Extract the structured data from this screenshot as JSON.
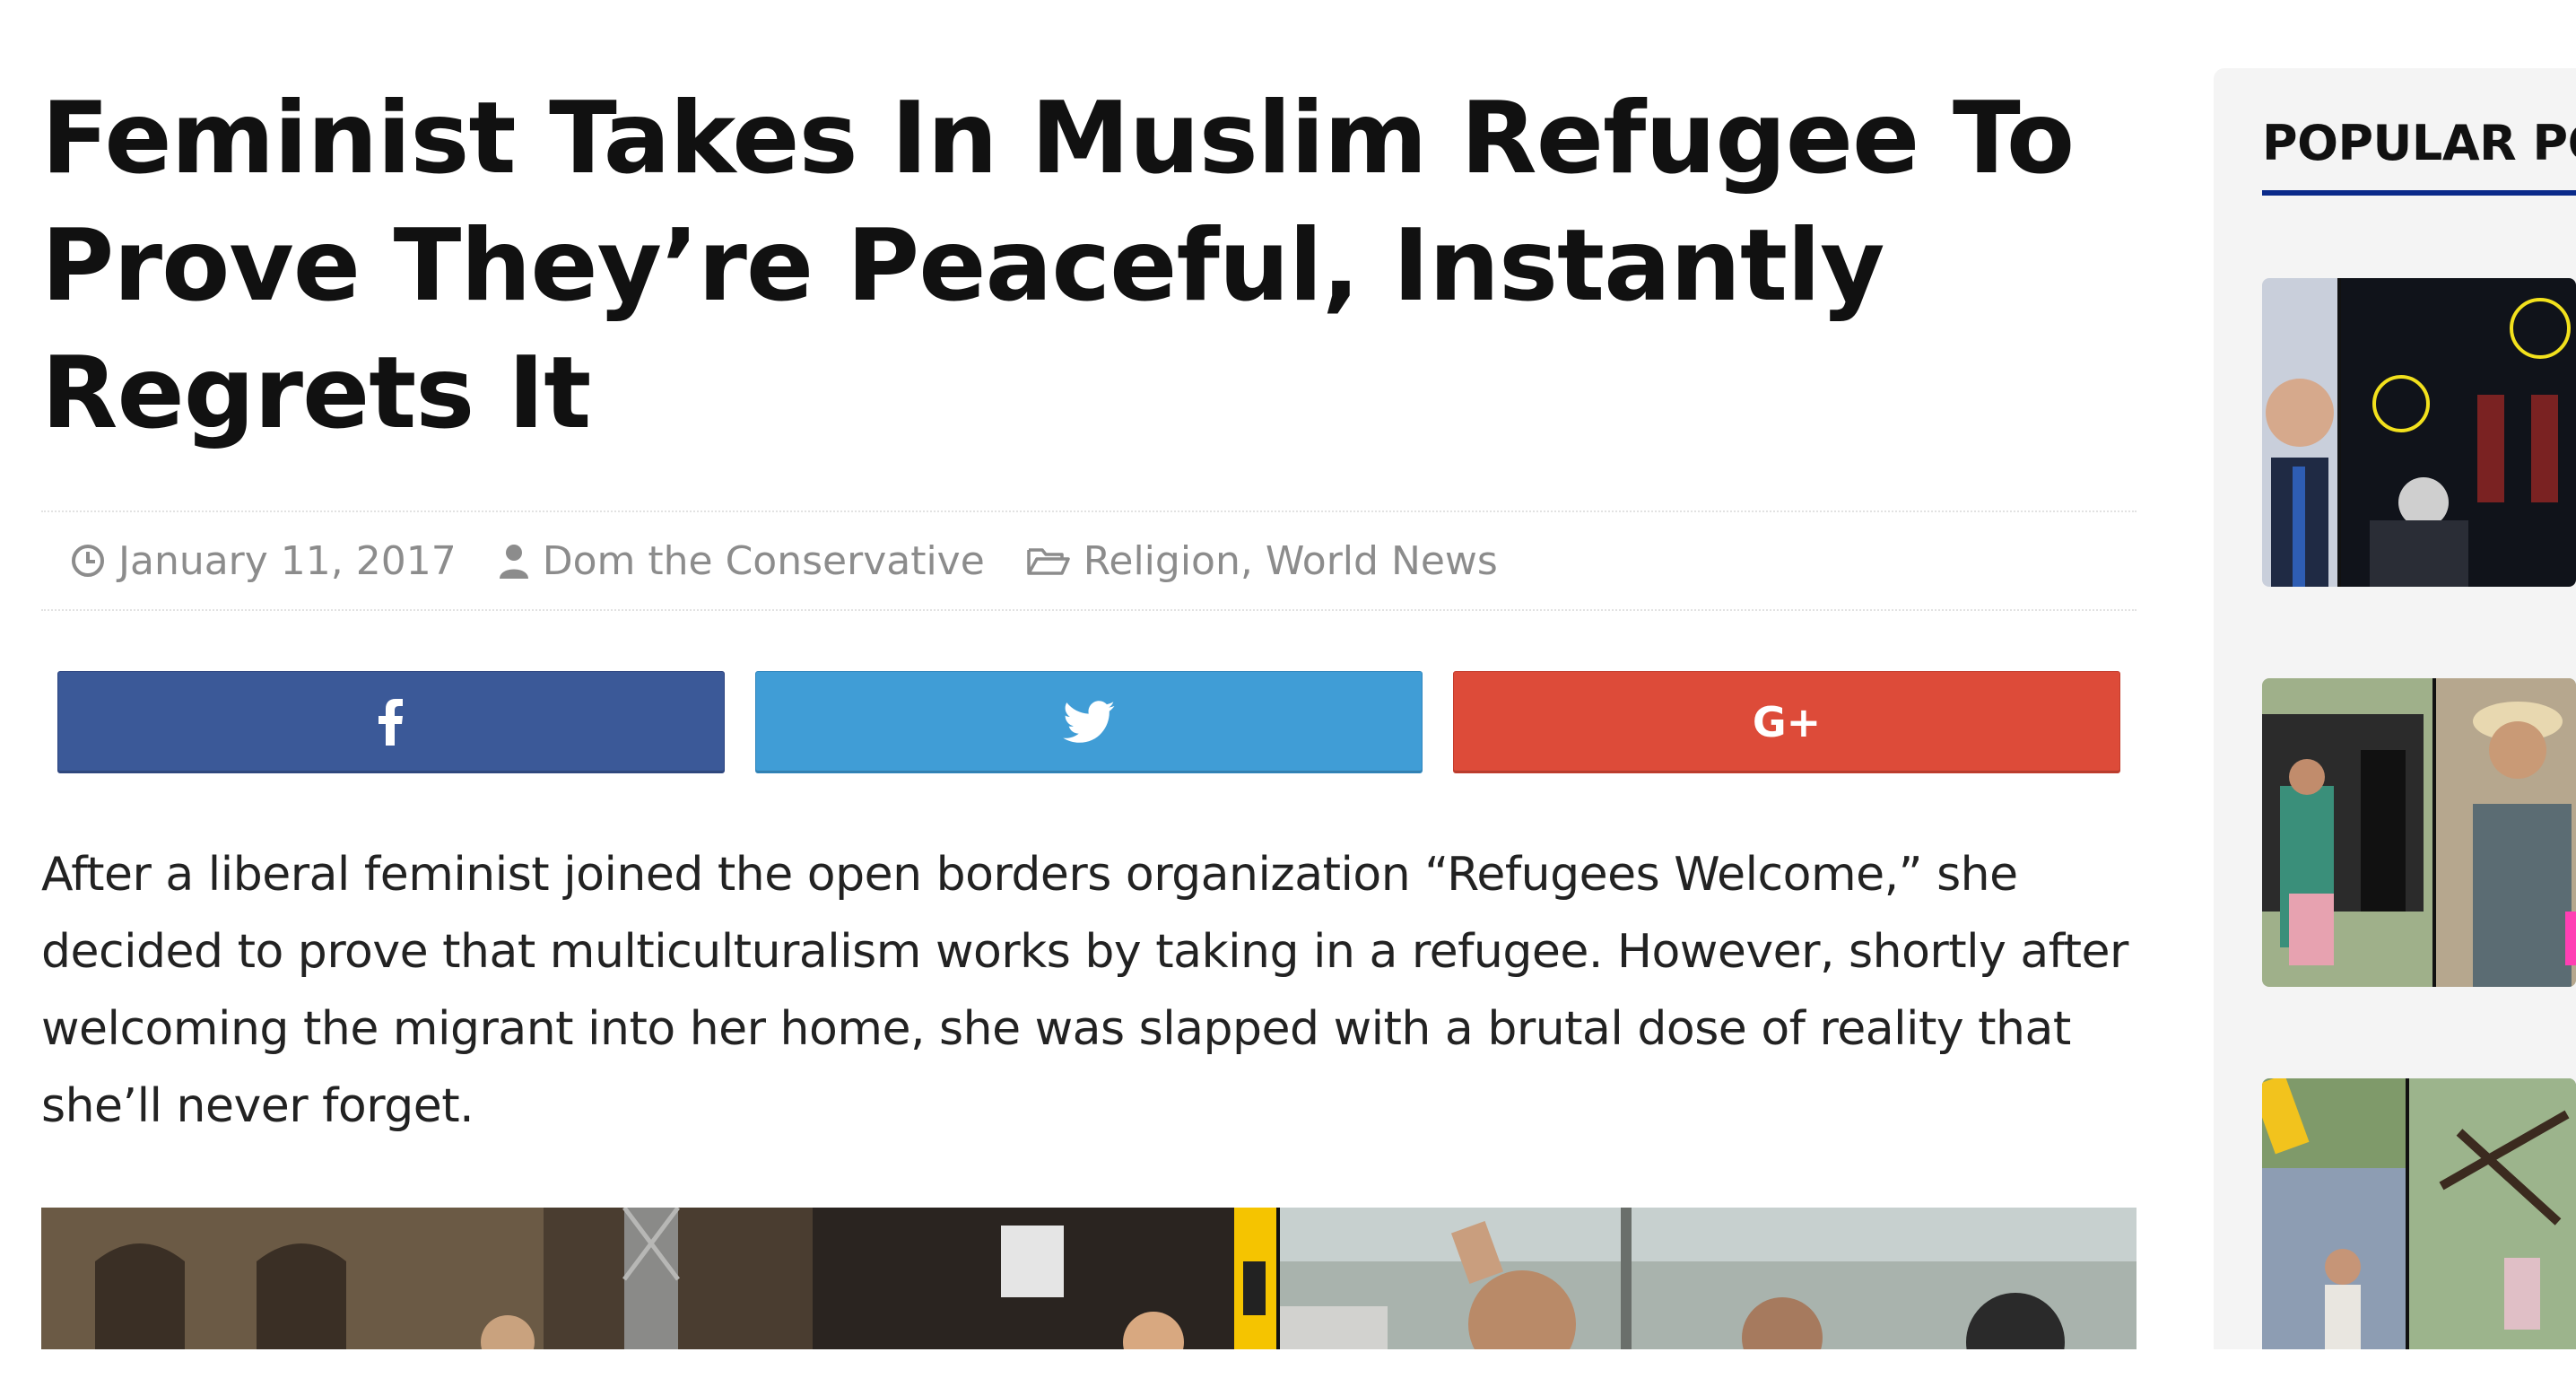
{
  "article": {
    "title": "Feminist Takes In Muslim Refugee To Prove They’re Peaceful, Instantly Regrets It",
    "meta": {
      "date": "January 11, 2017",
      "author": "Dom the Conservative",
      "category_1": "Religion",
      "category_separator": ",",
      "category_2": "World News"
    },
    "share": {
      "facebook_icon": "facebook-icon",
      "twitter_icon": "twitter-icon",
      "google_plus_label": "G+"
    },
    "intro": "After a liberal feminist joined the open borders organization “Refugees Welcome,” she decided to prove that multiculturalism works by taking in a refugee. However, shortly after welcoming the migrant into her home, she was slapped with a brutal dose of reality that she’ll never forget."
  },
  "sidebar": {
    "title": "POPULAR PO",
    "thumbnails": [
      "thumbnail-1",
      "thumbnail-2",
      "thumbnail-3"
    ]
  },
  "colors": {
    "facebook": "#3b5998",
    "twitter": "#409dd6",
    "google_plus": "#dd4b39",
    "sidebar_accent": "#0a2a8a"
  }
}
